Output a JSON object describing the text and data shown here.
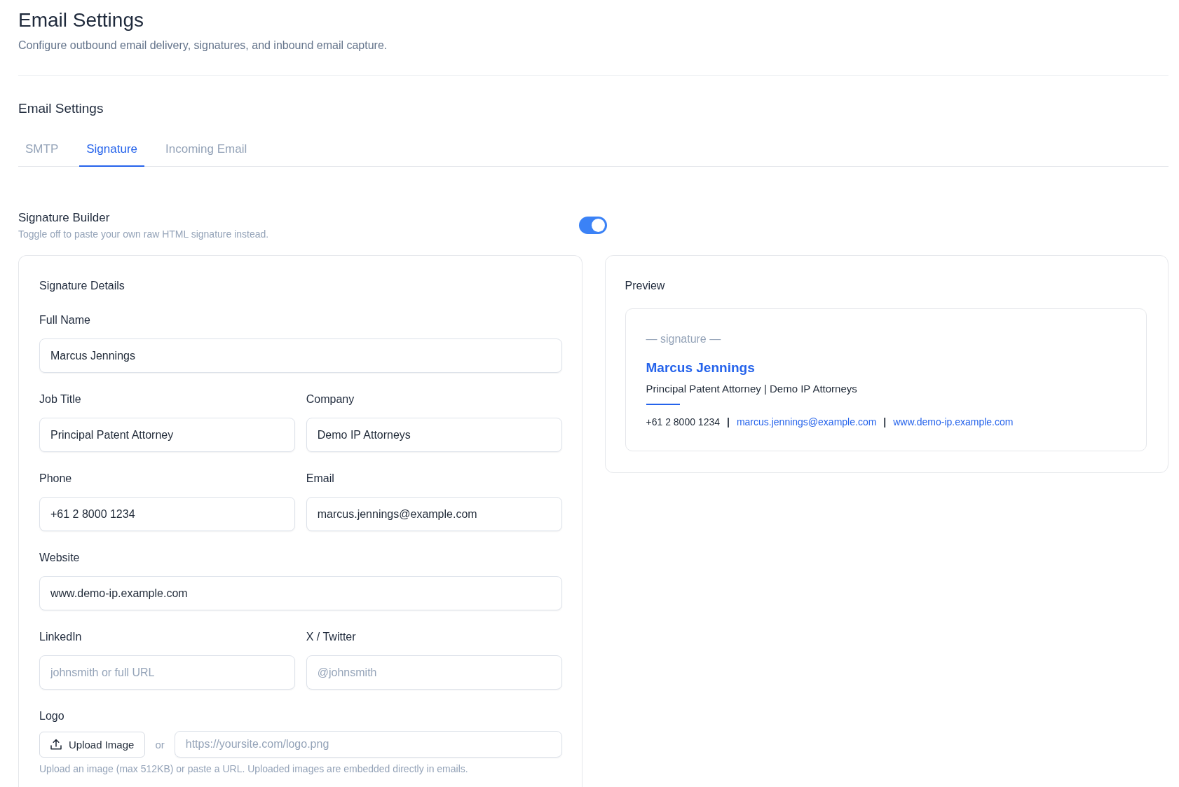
{
  "header": {
    "title": "Email Settings",
    "subtitle": "Configure outbound email delivery, signatures, and inbound email capture."
  },
  "section": {
    "title": "Email Settings"
  },
  "tabs": [
    {
      "label": "SMTP",
      "selected": false
    },
    {
      "label": "Signature",
      "selected": true
    },
    {
      "label": "Incoming Email",
      "selected": false
    }
  ],
  "signature_builder": {
    "label": "Signature Builder",
    "hint": "Toggle off to paste your own raw HTML signature instead.",
    "on": true
  },
  "details": {
    "title": "Signature Details",
    "rows": [
      {
        "fields": [
          {
            "label": "Full Name",
            "value": "Marcus Jennings"
          }
        ]
      },
      {
        "fields": [
          {
            "label": "Job Title",
            "value": "Principal Patent Attorney"
          },
          {
            "label": "Company",
            "value": "Demo IP Attorneys"
          }
        ]
      },
      {
        "fields": [
          {
            "label": "Phone",
            "value": "+61 2 8000 1234"
          },
          {
            "label": "Email",
            "value": "marcus.jennings@example.com"
          }
        ]
      },
      {
        "fields": [
          {
            "label": "Website",
            "value": "www.demo-ip.example.com"
          }
        ]
      },
      {
        "fields": [
          {
            "label": "LinkedIn",
            "placeholder": "johnsmith or full URL"
          },
          {
            "label": "X / Twitter",
            "placeholder": "@johnsmith"
          }
        ]
      }
    ],
    "logo": {
      "label": "Logo",
      "upload_button": "Upload Image",
      "separator": "or",
      "url_placeholder": "https://yoursite.com/logo.png",
      "hint": "Upload an image (max 512KB) or paste a URL. Uploaded images are embedded directly in emails."
    }
  },
  "preview": {
    "title": "Preview",
    "marker": "— signature —",
    "name": "Marcus Jennings",
    "subtitle": "Principal Patent Attorney | Demo IP Attorneys",
    "contacts": [
      {
        "kind": "text",
        "text": "+61 2 8000 1234"
      },
      {
        "kind": "separator",
        "text": "|"
      },
      {
        "kind": "link",
        "text": "marcus.jennings@example.com"
      },
      {
        "kind": "separator",
        "text": "|"
      },
      {
        "kind": "link",
        "text": "www.demo-ip.example.com"
      }
    ]
  }
}
